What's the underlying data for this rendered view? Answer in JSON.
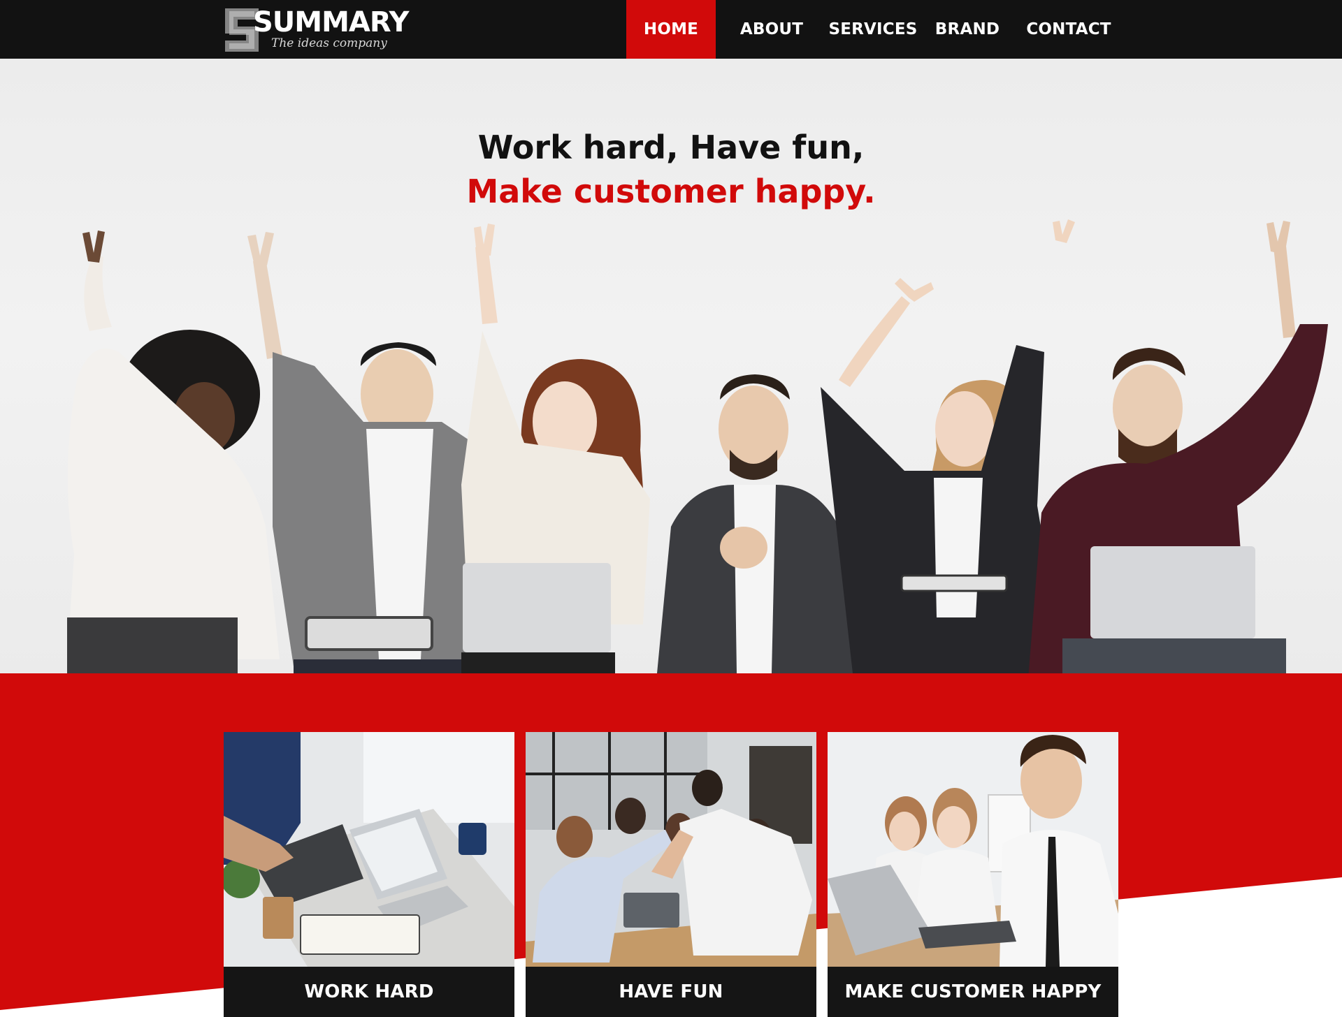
{
  "brand": {
    "name": "SUMMARY",
    "tagline": "The ideas company",
    "accent_color": "#d10a0a",
    "dark_color": "#121212"
  },
  "nav": {
    "items": [
      {
        "label": "HOME",
        "active": true
      },
      {
        "label": "ABOUT",
        "active": false
      },
      {
        "label": "SERVICES",
        "active": false
      },
      {
        "label": "BRAND",
        "active": false
      },
      {
        "label": "CONTACT",
        "active": false
      }
    ]
  },
  "hero": {
    "line1": "Work hard, Have fun,",
    "line2": "Make customer happy."
  },
  "cards": [
    {
      "label": "WORK HARD"
    },
    {
      "label": "HAVE FUN"
    },
    {
      "label": "MAKE CUSTOMER HAPPY"
    }
  ]
}
